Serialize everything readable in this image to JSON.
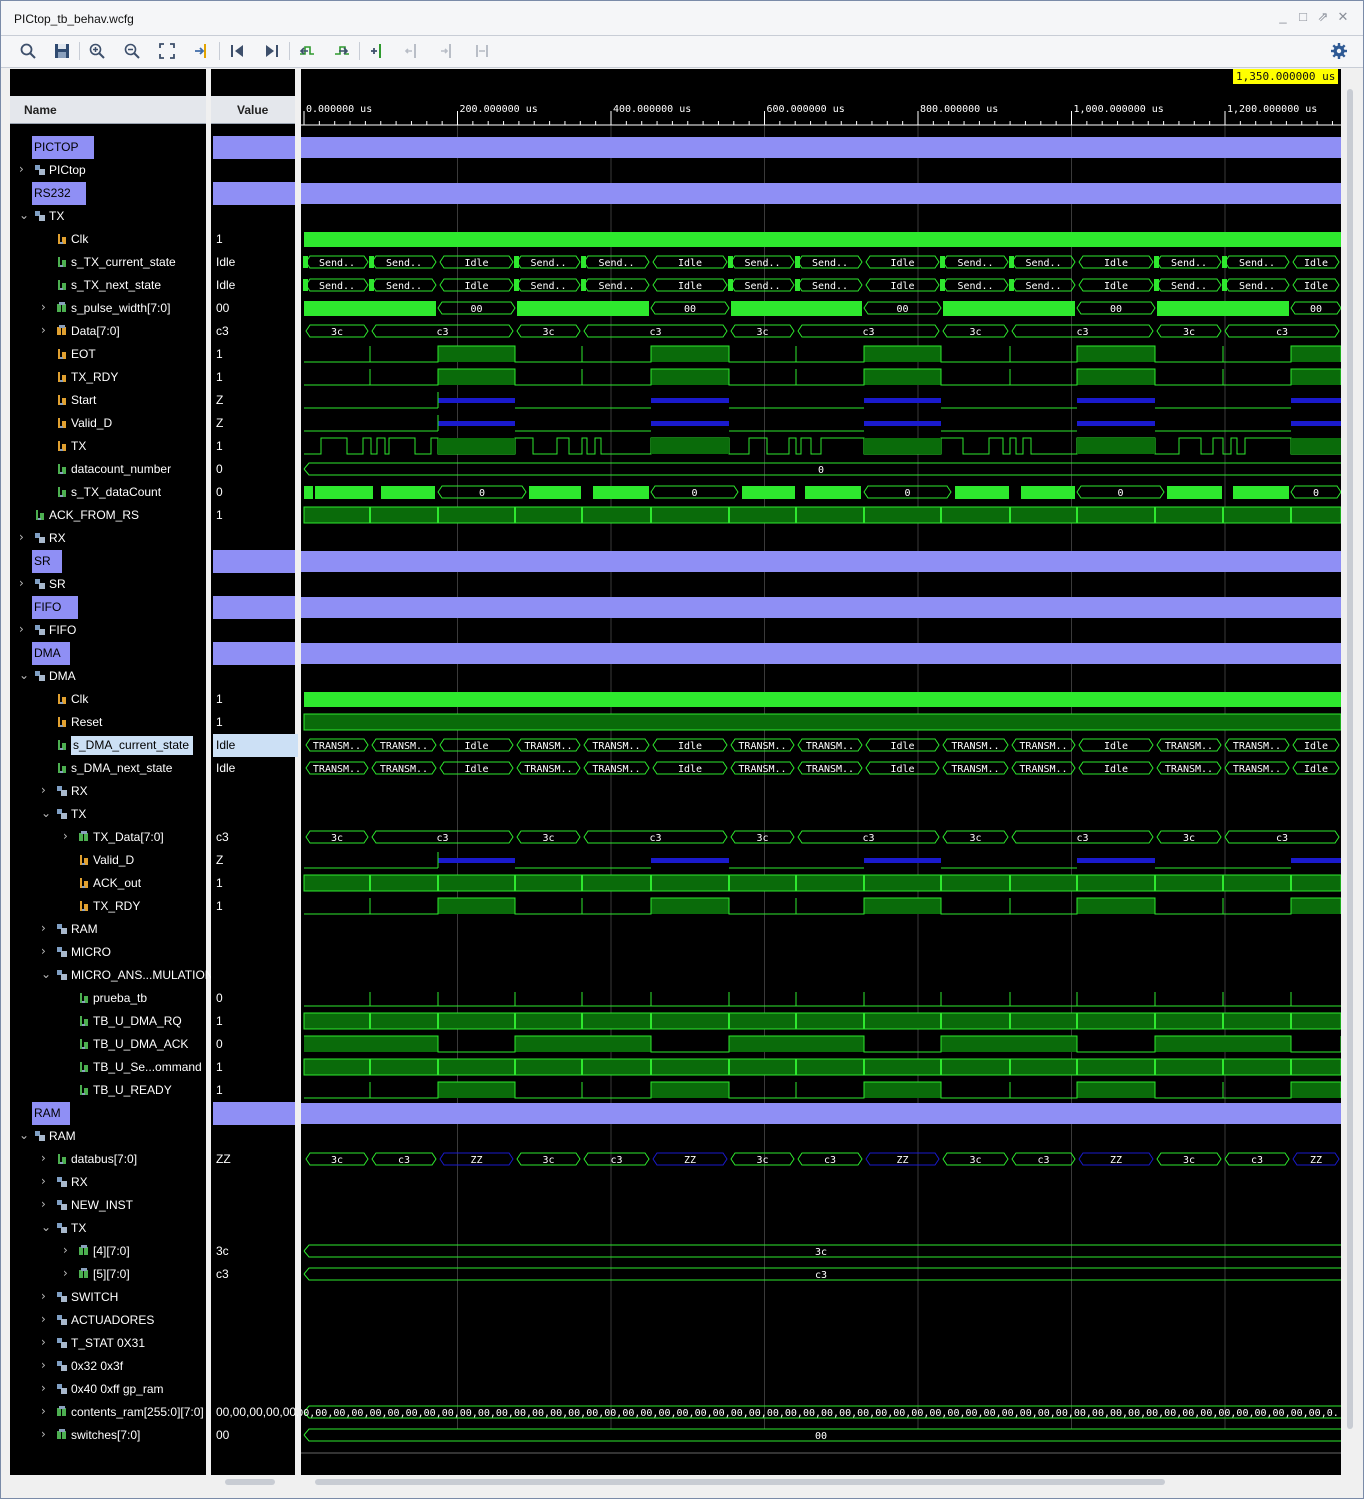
{
  "window": {
    "title": "PICtop_tb_behav.wcfg"
  },
  "columns": {
    "name": "Name",
    "value": "Value"
  },
  "cursor_readout": "1,350.000000 us",
  "time_ruler": {
    "ticks": [
      "0.000000 us",
      "200.000000 us",
      "400.000000 us",
      "600.000000 us",
      "800.000000 us",
      "1,000.000000 us",
      "1,200.000000 us"
    ]
  },
  "colors": {
    "wave_green": "#2ee82e",
    "fill_green": "#0a6b0a",
    "z_blue": "#1a1acc",
    "group": "#8f8ff5",
    "cursor": "#ffff00"
  },
  "rows": [
    {
      "type": "group",
      "name": "PICTOP",
      "value": ""
    },
    {
      "type": "scope",
      "name": "PICtop",
      "indent": 1,
      "expand": "collapsed",
      "value": ""
    },
    {
      "type": "group",
      "name": "RS232",
      "value": ""
    },
    {
      "type": "scope",
      "name": "TX",
      "indent": 1,
      "expand": "expanded",
      "value": ""
    },
    {
      "type": "clk",
      "name": "Clk",
      "indent": 2,
      "icon": "logic-bus",
      "value": "1"
    },
    {
      "type": "bus",
      "name": "s_TX_current_state",
      "indent": 2,
      "icon": "logic",
      "value": "Idle",
      "labels": [
        "Send..",
        "Send..",
        "Idle",
        "Send..",
        "Send..",
        "Idle",
        "Send..",
        "Send..",
        "Idle",
        "Send..",
        "Send..",
        "Idle",
        "Send..",
        "Send..",
        "Idle"
      ]
    },
    {
      "type": "bus",
      "name": "s_TX_next_state",
      "indent": 2,
      "icon": "logic",
      "value": "Idle",
      "labels": [
        "Send..",
        "Send..",
        "Idle",
        "Send..",
        "Send..",
        "Idle",
        "Send..",
        "Send..",
        "Idle",
        "Send..",
        "Send..",
        "Idle",
        "Send..",
        "Send..",
        "Idle"
      ]
    },
    {
      "type": "pulse",
      "name": "s_pulse_width[7:0]",
      "indent": 2,
      "expand": "collapsed",
      "icon": "vector",
      "value": "00",
      "labels": [
        "00",
        "00",
        "00",
        "00",
        "00"
      ]
    },
    {
      "type": "data",
      "name": "Data[7:0]",
      "indent": 2,
      "expand": "collapsed",
      "icon": "vector-orange",
      "value": "c3",
      "labels": [
        "3c",
        "c3",
        "3c",
        "c3",
        "3c",
        "c3",
        "3c",
        "c3",
        "3c",
        "c3"
      ]
    },
    {
      "type": "eot",
      "name": "EOT",
      "indent": 2,
      "icon": "logic-orange",
      "value": "1"
    },
    {
      "type": "eot",
      "name": "TX_RDY",
      "indent": 2,
      "icon": "logic-orange",
      "value": "1"
    },
    {
      "type": "z",
      "name": "Start",
      "indent": 2,
      "icon": "logic-orange",
      "value": "Z"
    },
    {
      "type": "z",
      "name": "Valid_D",
      "indent": 2,
      "icon": "logic-orange",
      "value": "Z"
    },
    {
      "type": "tx",
      "name": "TX",
      "indent": 2,
      "icon": "logic-orange",
      "value": "1"
    },
    {
      "type": "const",
      "name": "datacount_number",
      "indent": 2,
      "icon": "logic",
      "value": "0",
      "label": "0"
    },
    {
      "type": "count",
      "name": "s_TX_dataCount",
      "indent": 2,
      "icon": "logic",
      "value": "0",
      "labels": [
        "0",
        "0",
        "0",
        "0",
        "0"
      ]
    },
    {
      "type": "ack",
      "name": "ACK_FROM_RS",
      "indent": 1,
      "icon": "logic",
      "value": "1"
    },
    {
      "type": "scope",
      "name": "RX",
      "indent": 1,
      "expand": "collapsed",
      "value": ""
    },
    {
      "type": "group",
      "name": "SR",
      "value": ""
    },
    {
      "type": "scope",
      "name": "SR",
      "indent": 1,
      "expand": "collapsed",
      "value": ""
    },
    {
      "type": "group",
      "name": "FIFO",
      "value": ""
    },
    {
      "type": "scope",
      "name": "FIFO",
      "indent": 1,
      "expand": "collapsed",
      "value": ""
    },
    {
      "type": "group",
      "name": "DMA",
      "value": ""
    },
    {
      "type": "scope",
      "name": "DMA",
      "indent": 1,
      "expand": "expanded",
      "value": ""
    },
    {
      "type": "clk",
      "name": "Clk",
      "indent": 2,
      "icon": "logic-orange",
      "value": "1"
    },
    {
      "type": "high",
      "name": "Reset",
      "indent": 2,
      "icon": "logic-orange",
      "value": "1"
    },
    {
      "type": "bus",
      "name": "s_DMA_current_state",
      "indent": 2,
      "icon": "logic",
      "value": "Idle",
      "selected": true,
      "labels": [
        "TRANSM..",
        "TRANSM..",
        "Idle",
        "TRANSM..",
        "TRANSM..",
        "Idle",
        "TRANSM..",
        "TRANSM..",
        "Idle",
        "TRANSM..",
        "TRANSM..",
        "Idle",
        "TRANSM..",
        "TRANSM..",
        "Idle"
      ]
    },
    {
      "type": "bus",
      "name": "s_DMA_next_state",
      "indent": 2,
      "icon": "logic",
      "value": "Idle",
      "labels": [
        "TRANSM..",
        "TRANSM..",
        "Idle",
        "TRANSM..",
        "TRANSM..",
        "Idle",
        "TRANSM..",
        "TRANSM..",
        "Idle",
        "TRANSM..",
        "TRANSM..",
        "Idle",
        "TRANSM..",
        "TRANSM..",
        "Idle"
      ]
    },
    {
      "type": "scope",
      "name": "RX",
      "indent": 2,
      "expand": "collapsed",
      "value": ""
    },
    {
      "type": "scope",
      "name": "TX",
      "indent": 2,
      "expand": "expanded",
      "value": ""
    },
    {
      "type": "data",
      "name": "TX_Data[7:0]",
      "indent": 3,
      "expand": "collapsed",
      "icon": "vector",
      "value": "c3",
      "labels": [
        "3c",
        "c3",
        "3c",
        "c3",
        "3c",
        "c3",
        "3c",
        "c3",
        "3c",
        "c3"
      ]
    },
    {
      "type": "z",
      "name": "Valid_D",
      "indent": 3,
      "icon": "logic-orange",
      "value": "Z"
    },
    {
      "type": "ack",
      "name": "ACK_out",
      "indent": 3,
      "icon": "logic-orange",
      "value": "1"
    },
    {
      "type": "eot",
      "name": "TX_RDY",
      "indent": 3,
      "icon": "logic-orange",
      "value": "1"
    },
    {
      "type": "scope",
      "name": "RAM",
      "indent": 2,
      "expand": "collapsed",
      "value": ""
    },
    {
      "type": "scope",
      "name": "MICRO",
      "indent": 2,
      "expand": "collapsed",
      "value": ""
    },
    {
      "type": "scope",
      "name": "MICRO_ANS...MULATION",
      "indent": 2,
      "expand": "expanded",
      "value": ""
    },
    {
      "type": "spike",
      "name": "prueba_tb",
      "indent": 3,
      "icon": "logic",
      "value": "0"
    },
    {
      "type": "ack",
      "name": "TB_U_DMA_RQ",
      "indent": 3,
      "icon": "logic",
      "value": "1"
    },
    {
      "type": "dmaack",
      "name": "TB_U_DMA_ACK",
      "indent": 3,
      "icon": "logic",
      "value": "0"
    },
    {
      "type": "ack",
      "name": "TB_U_Se...ommand",
      "indent": 3,
      "icon": "logic",
      "value": "1"
    },
    {
      "type": "eot",
      "name": "TB_U_READY",
      "indent": 3,
      "icon": "logic",
      "value": "1"
    },
    {
      "type": "group",
      "name": "RAM",
      "value": ""
    },
    {
      "type": "scope",
      "name": "RAM",
      "indent": 1,
      "expand": "expanded",
      "value": ""
    },
    {
      "type": "databus",
      "name": "databus[7:0]",
      "indent": 2,
      "expand": "collapsed",
      "value": "ZZ",
      "labels": [
        "3c",
        "c3",
        "ZZ",
        "3c",
        "c3",
        "ZZ",
        "3c",
        "c3",
        "ZZ",
        "3c",
        "c3",
        "ZZ",
        "3c",
        "c3",
        "ZZ"
      ]
    },
    {
      "type": "scope",
      "name": "RX",
      "indent": 2,
      "expand": "collapsed",
      "value": ""
    },
    {
      "type": "scope",
      "name": "NEW_INST",
      "indent": 2,
      "expand": "collapsed",
      "value": ""
    },
    {
      "type": "scope",
      "name": "TX",
      "indent": 2,
      "expand": "expanded",
      "value": ""
    },
    {
      "type": "const",
      "name": "[4][7:0]",
      "indent": 3,
      "expand": "collapsed",
      "icon": "vector",
      "value": "3c",
      "label": "3c"
    },
    {
      "type": "const",
      "name": "[5][7:0]",
      "indent": 3,
      "expand": "collapsed",
      "icon": "vector",
      "value": "c3",
      "label": "c3"
    },
    {
      "type": "scope",
      "name": "SWITCH",
      "indent": 2,
      "expand": "collapsed",
      "value": ""
    },
    {
      "type": "scope",
      "name": "ACTUADORES",
      "indent": 2,
      "expand": "collapsed",
      "value": ""
    },
    {
      "type": "scope",
      "name": "T_STAT 0X31",
      "indent": 2,
      "expand": "collapsed",
      "value": ""
    },
    {
      "type": "scope",
      "name": "0x32 0x3f",
      "indent": 2,
      "expand": "collapsed",
      "value": ""
    },
    {
      "type": "scope",
      "name": "0x40 0xff gp_ram",
      "indent": 2,
      "expand": "collapsed",
      "value": ""
    },
    {
      "type": "const",
      "name": "contents_ram[255:0][7:0]",
      "indent": 2,
      "expand": "collapsed",
      "icon": "vector",
      "value": "00,00,00,00,00,",
      "label": "00,00,00,00,00,00,00,00,00,00,00,00,00,00,00,00,00,00,00,00,00,00,00,00,00,00,00,00,00,00,00,00,00,00,00,00,00,00,00,00,00,00,00,00,00,00,00,00,00,00,00,00,00,00,00,00,00,0.."
    },
    {
      "type": "const",
      "name": "switches[7:0]",
      "indent": 2,
      "expand": "collapsed",
      "icon": "vector",
      "value": "00",
      "label": "00"
    }
  ]
}
